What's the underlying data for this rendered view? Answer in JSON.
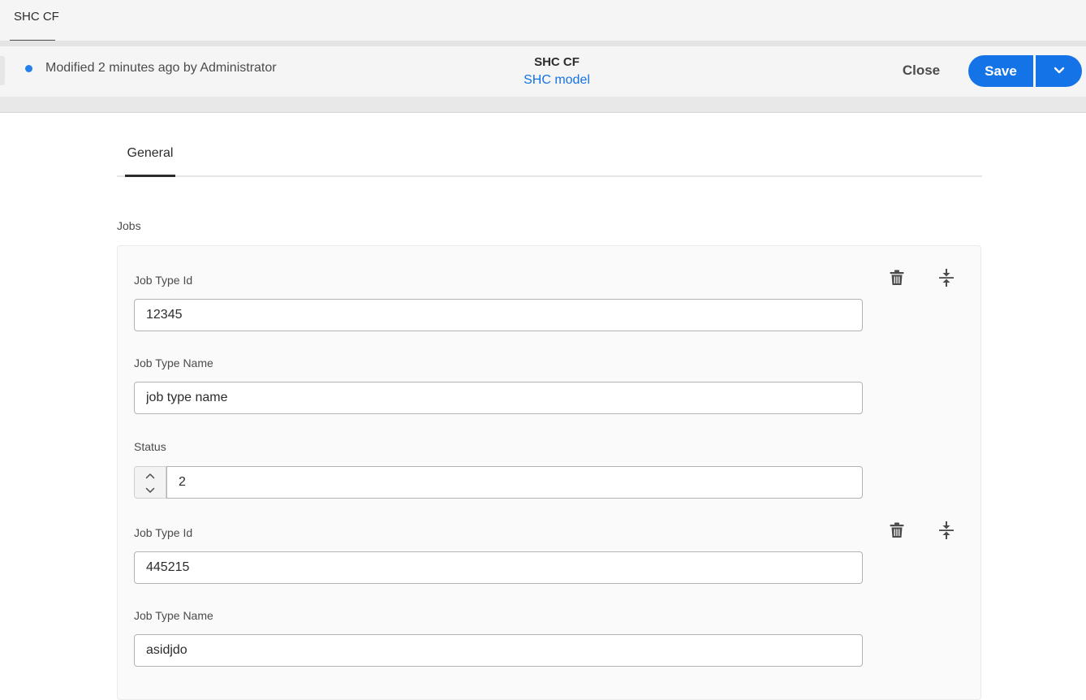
{
  "tabbar": {
    "tab_label": "SHC CF"
  },
  "header": {
    "modified_text": "Modified 2 minutes ago by Administrator",
    "title": "SHC CF",
    "model_link": "SHC model",
    "close_label": "Close",
    "save_label": "Save",
    "status_dot_color": "#2680eb",
    "accent_color": "#1473e6"
  },
  "form": {
    "tabs": [
      {
        "label": "General"
      }
    ],
    "jobs_label": "Jobs",
    "jobs": [
      {
        "job_type_id_label": "Job Type Id",
        "job_type_id_value": "12345",
        "job_type_name_label": "Job Type Name",
        "job_type_name_value": "job type name",
        "status_label": "Status",
        "status_value": "2",
        "delete_icon": "trash-icon",
        "reorder_icon": "collapse-vertical-icon"
      },
      {
        "job_type_id_label": "Job Type Id",
        "job_type_id_value": "445215",
        "job_type_name_label": "Job Type Name",
        "job_type_name_value": "asidjdo",
        "delete_icon": "trash-icon",
        "reorder_icon": "collapse-vertical-icon"
      }
    ]
  }
}
